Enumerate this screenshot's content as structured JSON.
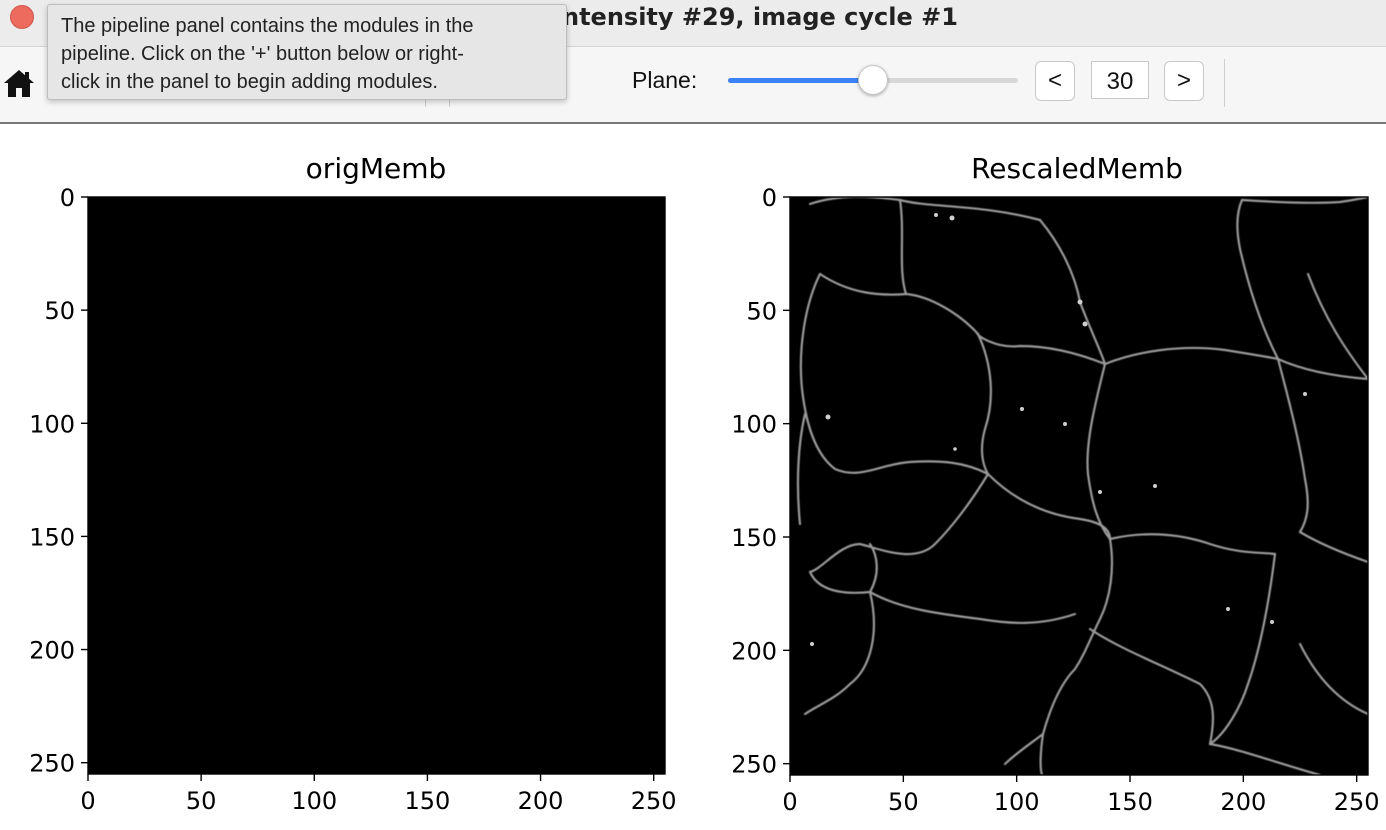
{
  "window": {
    "title": "ntensity #29, image cycle #1"
  },
  "tooltip": {
    "lines": [
      "The pipeline panel contains the modules in the",
      "pipeline. Click on the '+' button below or right-",
      "click in the panel to begin adding modules."
    ]
  },
  "toolbar": {
    "home_icon": "home-icon",
    "plane_label": "Plane:",
    "plane_value": "30",
    "plane_slider_fraction": 0.5,
    "prev_label": "<",
    "next_label": ">"
  },
  "colors": {
    "close_button": "#ec6a5e",
    "slider_accent": "#3b82f6"
  },
  "chart_data": [
    {
      "type": "heatmap",
      "title": "origMemb",
      "xlim": [
        0,
        255
      ],
      "ylim": [
        255,
        0
      ],
      "x_ticks": [
        0,
        50,
        100,
        150,
        200,
        250
      ],
      "y_ticks": [
        0,
        50,
        100,
        150,
        200,
        250
      ],
      "colormap": "gray",
      "content": "near-black image"
    },
    {
      "type": "heatmap",
      "title": "RescaledMemb",
      "xlim": [
        0,
        255
      ],
      "ylim": [
        255,
        0
      ],
      "x_ticks": [
        0,
        50,
        100,
        150,
        200,
        250
      ],
      "y_ticks": [
        0,
        50,
        100,
        150,
        200,
        250
      ],
      "colormap": "gray",
      "content": "cell membrane outlines"
    }
  ]
}
